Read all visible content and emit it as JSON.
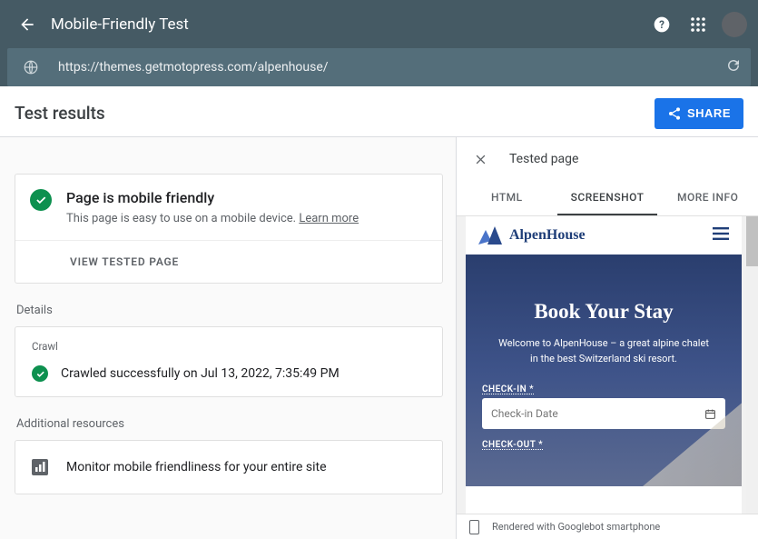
{
  "topbar": {
    "title": "Mobile-Friendly Test"
  },
  "url": "https://themes.getmotopress.com/alpenhouse/",
  "results": {
    "title": "Test results",
    "share": "SHARE"
  },
  "status": {
    "title": "Page is mobile friendly",
    "subtitle": "This page is easy to use on a mobile device.",
    "learn_more": "Learn more",
    "view_tested": "VIEW TESTED PAGE"
  },
  "details": {
    "label": "Details",
    "crawl_label": "Crawl",
    "crawl_status": "Crawled successfully on Jul 13, 2022, 7:35:49 PM"
  },
  "resources": {
    "label": "Additional resources",
    "monitor": "Monitor mobile friendliness for your entire site"
  },
  "panel": {
    "title": "Tested page",
    "tabs": {
      "html": "HTML",
      "screenshot": "SCREENSHOT",
      "more": "MORE INFO"
    },
    "render_note": "Rendered with Googlebot smartphone"
  },
  "preview": {
    "brand": "AlpenHouse",
    "hero_title": "Book Your Stay",
    "hero_sub": "Welcome to AlpenHouse – a great alpine chalet in the best Switzerland ski resort.",
    "checkin_label": "CHECK-IN *",
    "checkin_placeholder": "Check-in Date",
    "checkout_label": "CHECK-OUT *"
  }
}
